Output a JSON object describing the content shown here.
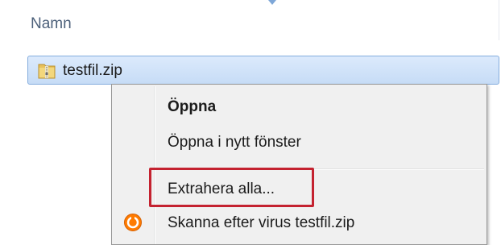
{
  "column_header": {
    "name_label": "Namn"
  },
  "file": {
    "name": "testfil.zip",
    "icon": "zip-folder-icon"
  },
  "context_menu": {
    "items": [
      {
        "label": "Öppna",
        "bold": true
      },
      {
        "label": "Öppna i nytt fönster",
        "bold": false
      },
      {
        "label": "Extrahera alla...",
        "bold": false,
        "highlighted": true
      },
      {
        "label": "Skanna efter virus testfil.zip",
        "bold": false,
        "icon": "antivirus-icon"
      }
    ]
  },
  "colors": {
    "selection_border": "#84acdd",
    "highlight_border": "#c42230",
    "menu_background": "#f0f0f0",
    "scan_icon": "#ff7b00"
  }
}
